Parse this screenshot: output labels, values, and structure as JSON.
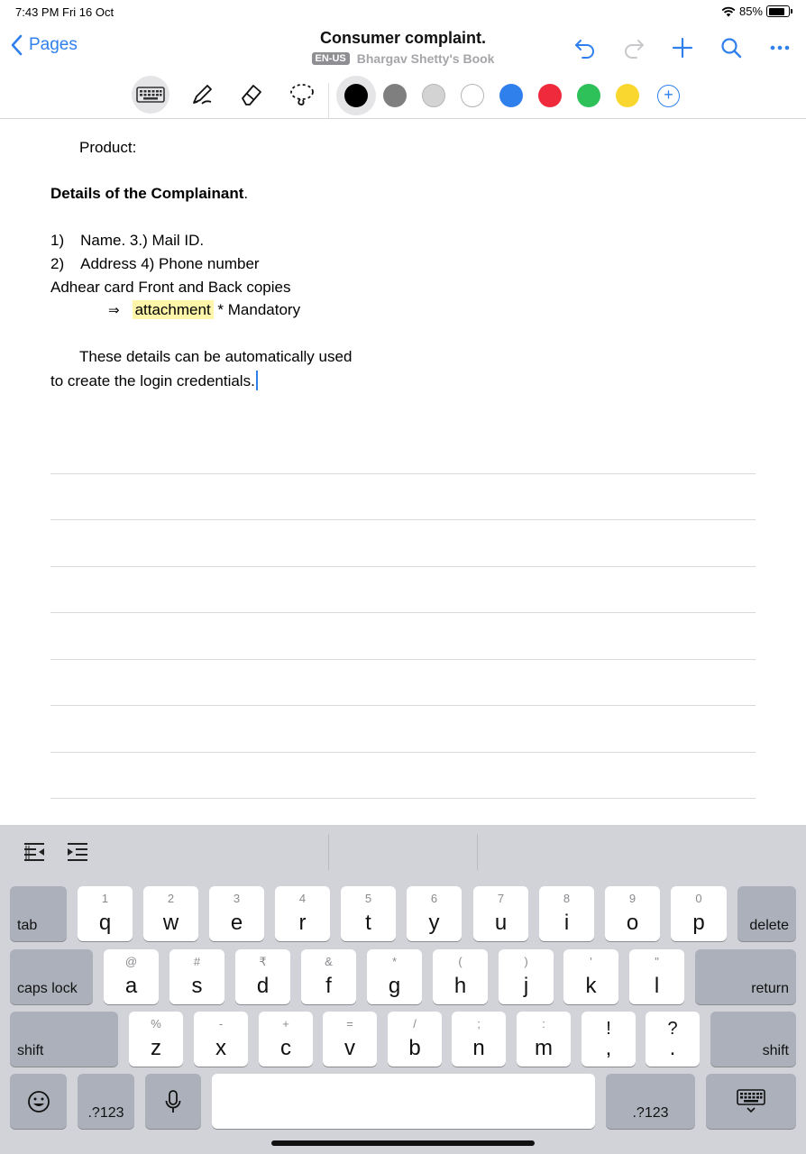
{
  "status_bar": {
    "time": "7:43 PM   Fri 16 Oct",
    "battery": "85%"
  },
  "nav": {
    "back_label": "Pages",
    "title": "Consumer complaint.",
    "language": "EN-US",
    "book": "Bhargav Shetty's Book",
    "icons": [
      "undo-icon",
      "redo-icon",
      "add-icon",
      "search-icon",
      "more-icon"
    ]
  },
  "toolbar": {
    "tools": [
      "keyboard-icon",
      "pen-icon",
      "eraser-icon",
      "lasso-icon"
    ],
    "colors": [
      "#000000",
      "#7f7f7f",
      "#d3d3d3",
      "#ffffff",
      "#2f80ed",
      "#ee2a3c",
      "#2ec15a",
      "#f9d72f"
    ],
    "add_color_label": "+"
  },
  "document": {
    "line_product": "Product:",
    "heading": "Details of the Complainant",
    "heading_period": ".",
    "item1_num": "1)",
    "item1_text": "Name. 3.) Mail ID.",
    "item2_num": "2)",
    "item2_text": "Address 4) Phone number",
    "line_aadhar": "Adhear card Front and Back copies",
    "arrow": "⇒",
    "highlight": "attachment",
    "mandatory": "* Mandatory",
    "para1": "These details can be automatically used",
    "para2": "to create the login credentials."
  },
  "keyboard": {
    "row1": {
      "tab": "tab",
      "keys": [
        {
          "sub": "1",
          "main": "q"
        },
        {
          "sub": "2",
          "main": "w"
        },
        {
          "sub": "3",
          "main": "e"
        },
        {
          "sub": "4",
          "main": "r"
        },
        {
          "sub": "5",
          "main": "t"
        },
        {
          "sub": "6",
          "main": "y"
        },
        {
          "sub": "7",
          "main": "u"
        },
        {
          "sub": "8",
          "main": "i"
        },
        {
          "sub": "9",
          "main": "o"
        },
        {
          "sub": "0",
          "main": "p"
        }
      ],
      "delete": "delete"
    },
    "row2": {
      "caps": "caps lock",
      "keys": [
        {
          "sub": "@",
          "main": "a"
        },
        {
          "sub": "#",
          "main": "s"
        },
        {
          "sub": "₹",
          "main": "d"
        },
        {
          "sub": "&",
          "main": "f"
        },
        {
          "sub": "*",
          "main": "g"
        },
        {
          "sub": "(",
          "main": "h"
        },
        {
          "sub": ")",
          "main": "j"
        },
        {
          "sub": "'",
          "main": "k"
        },
        {
          "sub": "\"",
          "main": "l"
        }
      ],
      "return": "return"
    },
    "row3": {
      "shift": "shift",
      "keys": [
        {
          "sub": "%",
          "main": "z"
        },
        {
          "sub": "-",
          "main": "x"
        },
        {
          "sub": "+",
          "main": "c"
        },
        {
          "sub": "=",
          "main": "v"
        },
        {
          "sub": "/",
          "main": "b"
        },
        {
          "sub": ";",
          "main": "n"
        },
        {
          "sub": ":",
          "main": "m"
        },
        {
          "sub": "!",
          "main": ","
        },
        {
          "sub": "?",
          "main": "."
        }
      ],
      "shift_right": "shift"
    },
    "row4": {
      "numbers_left": ".?123",
      "numbers_right": ".?123"
    }
  }
}
